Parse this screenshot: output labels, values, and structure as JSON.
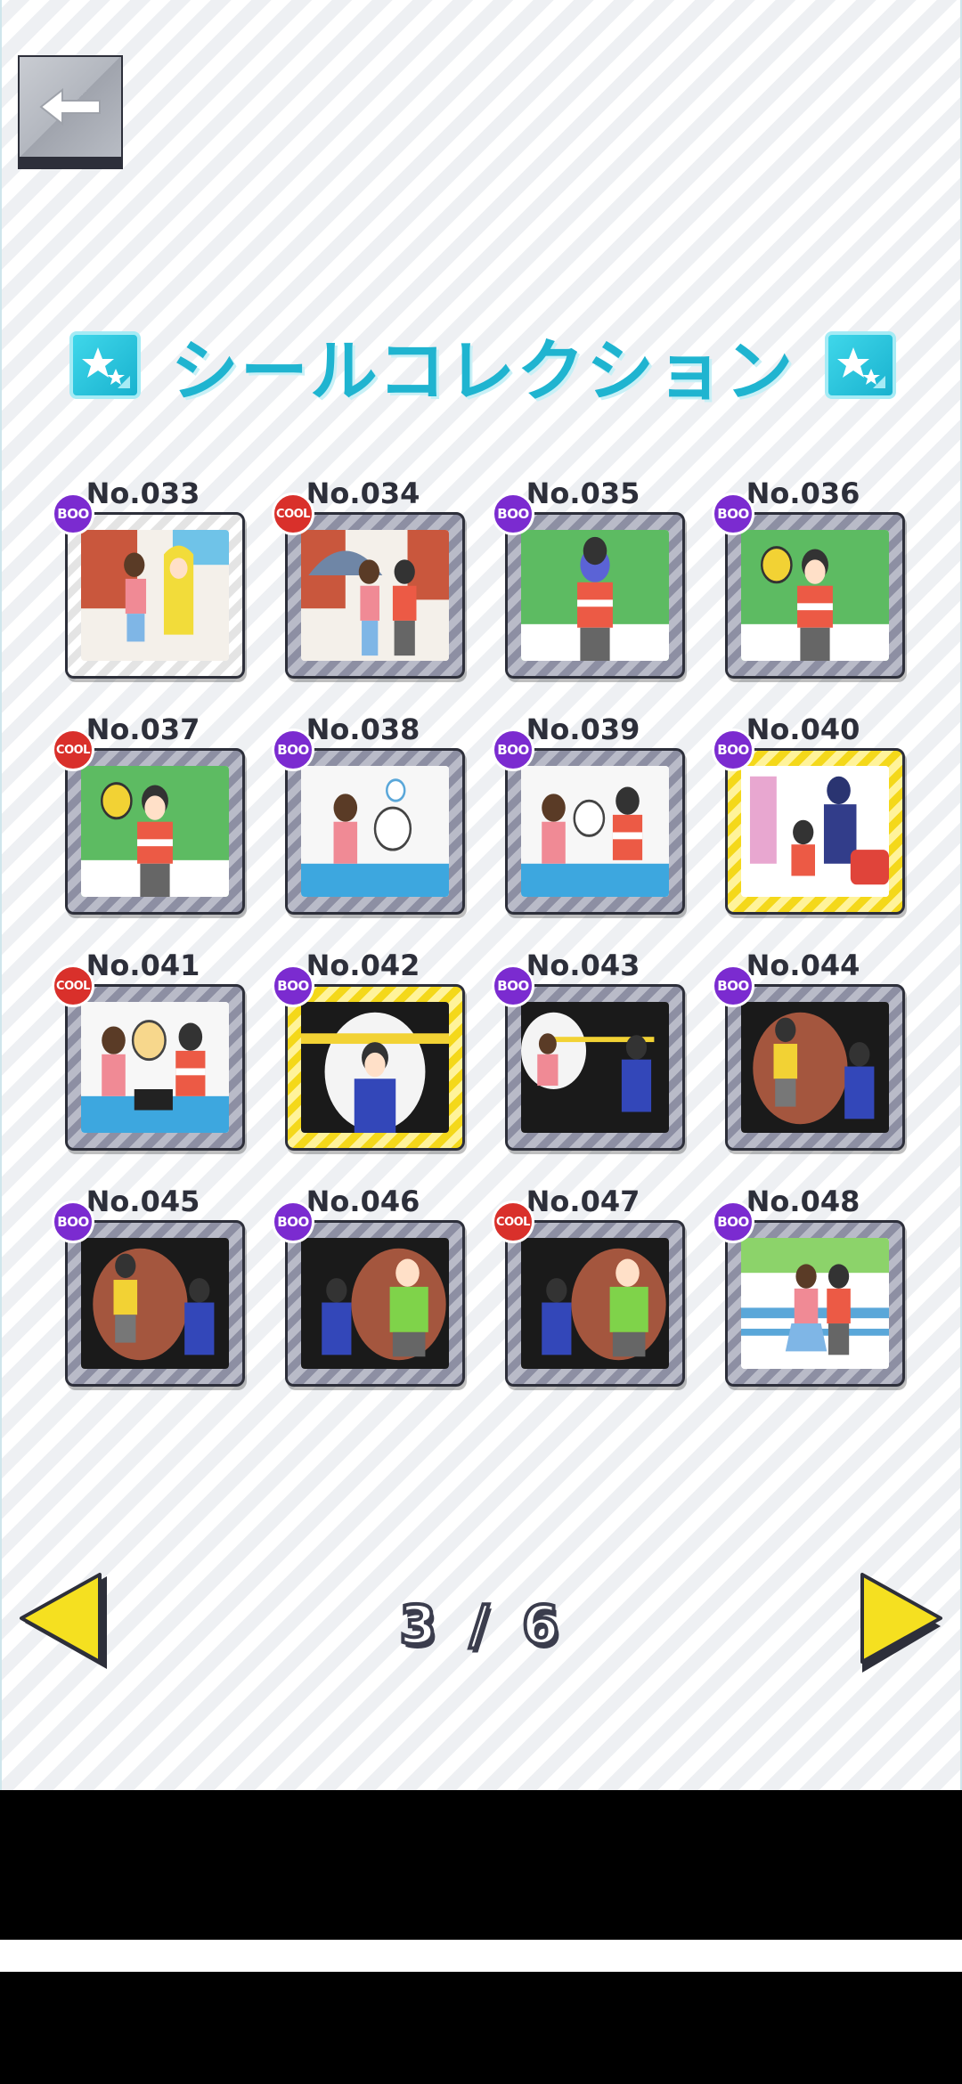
{
  "header": {
    "back_icon": "back-arrow-icon"
  },
  "title": {
    "text": "シールコレクション",
    "icon": "sticker-star-icon"
  },
  "stickers": [
    {
      "number": "No.033",
      "badge": "BOO",
      "frame": "silver",
      "scene": "rain"
    },
    {
      "number": "No.034",
      "badge": "COOL",
      "frame": "gray",
      "scene": "umbrella"
    },
    {
      "number": "No.035",
      "badge": "BOO",
      "frame": "gray",
      "scene": "field"
    },
    {
      "number": "No.036",
      "badge": "BOO",
      "frame": "gray",
      "scene": "ball"
    },
    {
      "number": "No.037",
      "badge": "COOL",
      "frame": "gray",
      "scene": "ball"
    },
    {
      "number": "No.038",
      "badge": "BOO",
      "frame": "gray",
      "scene": "crane"
    },
    {
      "number": "No.039",
      "badge": "BOO",
      "frame": "gray",
      "scene": "crane2"
    },
    {
      "number": "No.040",
      "badge": "BOO",
      "frame": "gold",
      "scene": "police"
    },
    {
      "number": "No.041",
      "badge": "COOL",
      "frame": "gray",
      "scene": "cat"
    },
    {
      "number": "No.042",
      "badge": "BOO",
      "frame": "gold",
      "scene": "spot"
    },
    {
      "number": "No.043",
      "badge": "BOO",
      "frame": "gray",
      "scene": "dark"
    },
    {
      "number": "No.044",
      "badge": "BOO",
      "frame": "gray",
      "scene": "brick"
    },
    {
      "number": "No.045",
      "badge": "BOO",
      "frame": "gray",
      "scene": "brick"
    },
    {
      "number": "No.046",
      "badge": "BOO",
      "frame": "gray",
      "scene": "brick2"
    },
    {
      "number": "No.047",
      "badge": "COOL",
      "frame": "gray",
      "scene": "brick2"
    },
    {
      "number": "No.048",
      "badge": "BOO",
      "frame": "gray",
      "scene": "bench"
    }
  ],
  "pagination": {
    "text": "3 / 6",
    "current": 3,
    "total": 6,
    "prev_icon": "left-triangle-icon",
    "next_icon": "right-triangle-icon"
  },
  "colors": {
    "title": "#1fb4d0",
    "boo": "#7b2bd0",
    "cool": "#d9302b",
    "arrow": "#f5e020"
  }
}
